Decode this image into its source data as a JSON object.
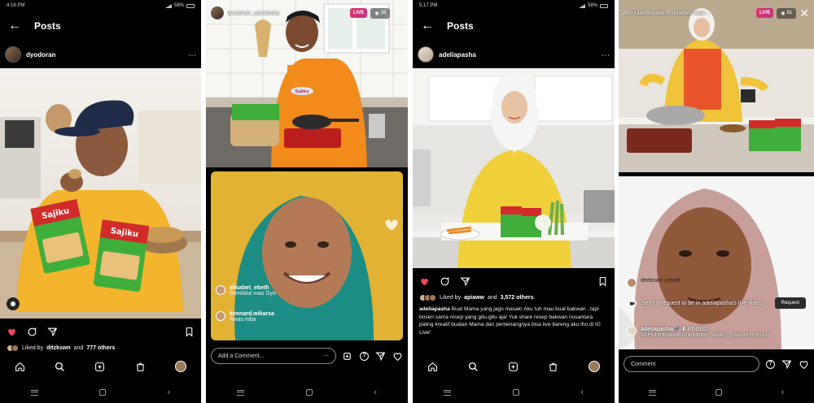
{
  "screen1": {
    "status": {
      "time": "4:16 PM",
      "battery": "58%"
    },
    "header": {
      "title": "Posts"
    },
    "post": {
      "username": "dyodoran",
      "liked_by_prefix": "Liked by",
      "liked_by_user": "ditzkswn",
      "and_text": "and",
      "others": "777 others"
    }
  },
  "screen2": {
    "live": {
      "title": "dyodoran_aprilliafiya",
      "badge": "LIVE",
      "viewers": "28"
    },
    "comments": [
      {
        "name": "elisabet_ebeth",
        "text": "Semlidut mas Dyo"
      },
      {
        "name": "kennard.wikarsa",
        "text": "Awas mba"
      }
    ],
    "input_placeholder": "Add a Comment..."
  },
  "screen3": {
    "status": {
      "time": "5:17 PM",
      "battery": "58%"
    },
    "header": {
      "title": "Posts"
    },
    "post": {
      "username": "adeliapasha",
      "liked_by_prefix": "Liked by",
      "liked_by_user": "apiaww",
      "and_text": "and",
      "others": "3,572 others",
      "caption_user": "adeliapasha",
      "caption": "Buat Mama yang jago masak! Aku tuh mau buat bakwan , tapi bosen sama resep yang gitu-gitu aja! Yuk share resep bakwan nusantara paling kreatif buatan Mama dan pemenangnya bisa live bareng aku iho di IG Live!"
    }
  },
  "screen4": {
    "live": {
      "title": "#KejutanBakwanRamadan Sajik...",
      "badge": "LIVE",
      "viewers": "61"
    },
    "join_text": "deekswn joined",
    "request_text": "Send a request to be in adeliapasha's live video.",
    "request_button": "Request",
    "pinned": {
      "user": "adeliapasha",
      "label": "PINNED",
      "text": "#KejutanBakwanRamadan Sajiku @dapurumami.id"
    },
    "input_placeholder": "Comment"
  }
}
